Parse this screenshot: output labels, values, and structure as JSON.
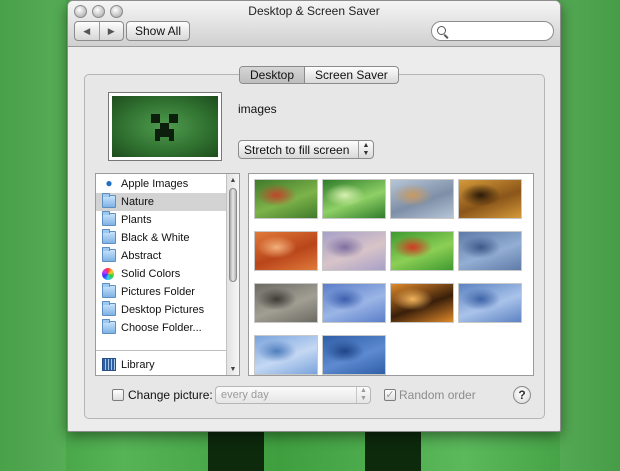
{
  "window": {
    "title": "Desktop & Screen Saver",
    "nav_back": "◀",
    "nav_forward": "▶",
    "show_all_label": "Show All",
    "search_placeholder": ""
  },
  "tabs": [
    {
      "label": "Desktop",
      "active": true
    },
    {
      "label": "Screen Saver",
      "active": false
    }
  ],
  "current": {
    "image_name": "images",
    "fit_option": "Stretch to fill screen"
  },
  "sources": [
    {
      "label": "Apple Images",
      "icon": "apple-icon",
      "selected": false
    },
    {
      "label": "Nature",
      "icon": "folder-icon",
      "selected": true
    },
    {
      "label": "Plants",
      "icon": "folder-icon",
      "selected": false
    },
    {
      "label": "Black & White",
      "icon": "folder-icon",
      "selected": false
    },
    {
      "label": "Abstract",
      "icon": "folder-icon",
      "selected": false
    },
    {
      "label": "Solid Colors",
      "icon": "color-wheel-icon",
      "selected": false
    },
    {
      "label": "Pictures Folder",
      "icon": "pictures-folder-icon",
      "selected": false
    },
    {
      "label": "Desktop Pictures",
      "icon": "folder-icon",
      "selected": false
    },
    {
      "label": "Choose Folder...",
      "icon": "folder-icon",
      "selected": false
    },
    {
      "label": "Library",
      "icon": "library-icon",
      "selected": false
    }
  ],
  "thumbnails": [
    {
      "name": "ladybug-leaves",
      "colors": [
        "#3f7a2a",
        "#7db34a",
        "#c0462a"
      ]
    },
    {
      "name": "grass-dew",
      "colors": [
        "#2e7c2a",
        "#8fd066",
        "#d7f0b0"
      ]
    },
    {
      "name": "beach-sunset",
      "colors": [
        "#b7c5d6",
        "#7d8fa8",
        "#c89a62"
      ]
    },
    {
      "name": "leopard-fur",
      "colors": [
        "#d59a3a",
        "#8a5519",
        "#2b1a08"
      ]
    },
    {
      "name": "orange-canyon",
      "colors": [
        "#e07a3a",
        "#b9451a",
        "#f3b07a"
      ]
    },
    {
      "name": "sand-dunes",
      "colors": [
        "#a8a0c8",
        "#d8c4c8",
        "#7e6fa0"
      ]
    },
    {
      "name": "ladybug-leaf",
      "colors": [
        "#3f9a2f",
        "#8ccf55",
        "#d13a22"
      ]
    },
    {
      "name": "blue-ripples",
      "colors": [
        "#5e7aa8",
        "#93aed3",
        "#3d5888"
      ]
    },
    {
      "name": "pebbles",
      "colors": [
        "#6b6b63",
        "#a29e93",
        "#3d3c36"
      ]
    },
    {
      "name": "blue-waves",
      "colors": [
        "#5b7ec9",
        "#9bb5e6",
        "#3c5fae"
      ]
    },
    {
      "name": "tiger-stripes",
      "colors": [
        "#e08a2a",
        "#3a1f0a",
        "#f2b45c"
      ]
    },
    {
      "name": "water-surface",
      "colors": [
        "#5c82c2",
        "#a9c3ea",
        "#3d63a6"
      ]
    },
    {
      "name": "blue-sky-water",
      "colors": [
        "#7aa3dc",
        "#c4d8f3",
        "#4f7dbe"
      ]
    },
    {
      "name": "blue-texture",
      "colors": [
        "#2f5fa8",
        "#5d8ad0",
        "#1f4588"
      ]
    }
  ],
  "bottom": {
    "change_picture_label": "Change picture:",
    "change_picture_checked": false,
    "interval_value": "every day",
    "random_order_label": "Random order",
    "random_order_checked": true,
    "help_label": "?"
  }
}
